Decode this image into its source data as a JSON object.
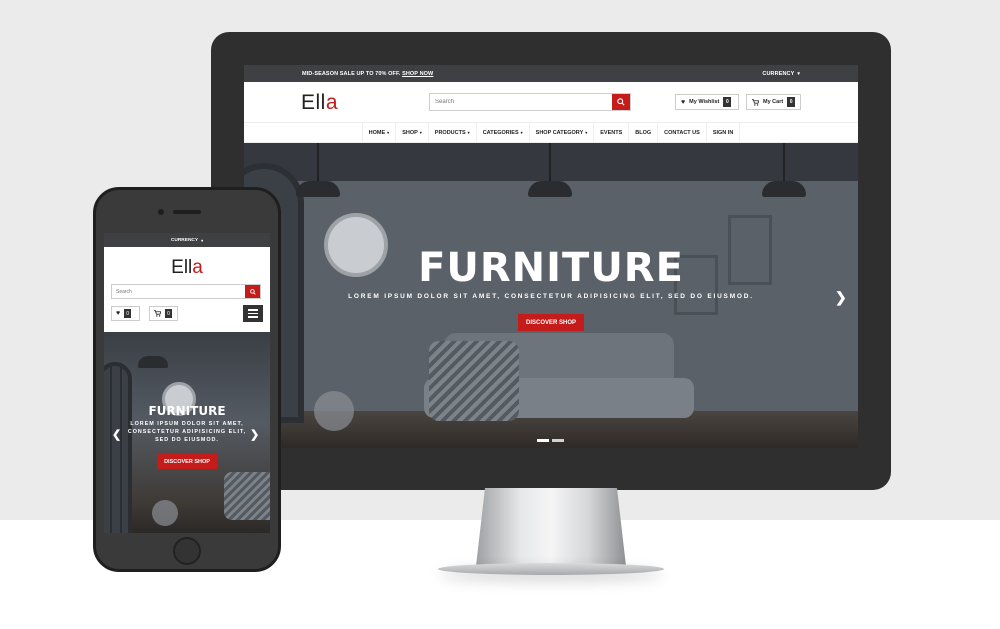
{
  "colors": {
    "accent": "#c41b1b",
    "topbar": "#3e4044",
    "device": "#2f2f2f"
  },
  "desktop": {
    "topbar": {
      "promo": "MID-SEASON SALE UP TO 70% OFF.",
      "promo_link": "SHOP NOW",
      "currency": "CURRENCY"
    },
    "logo": {
      "main": "Ell",
      "accent": "a"
    },
    "search": {
      "placeholder": "Search"
    },
    "wishlist": {
      "label": "My Wishlist",
      "count": "0"
    },
    "cart": {
      "label": "My Cart",
      "count": "0"
    },
    "nav": [
      {
        "label": "HOME",
        "dropdown": true
      },
      {
        "label": "SHOP",
        "dropdown": true
      },
      {
        "label": "PRODUCTS",
        "dropdown": true
      },
      {
        "label": "CATEGORIES",
        "dropdown": true
      },
      {
        "label": "SHOP CATEGORY",
        "dropdown": true
      },
      {
        "label": "EVENTS",
        "dropdown": false
      },
      {
        "label": "BLOG",
        "dropdown": false
      },
      {
        "label": "CONTACT US",
        "dropdown": false
      },
      {
        "label": "SIGN IN",
        "dropdown": false
      }
    ],
    "hero": {
      "title": "FURNITURE",
      "subtitle": "LOREM IPSUM DOLOR SIT AMET, CONSECTETUR ADIPISICING ELIT, SED DO EIUSMOD.",
      "button": "DISCOVER SHOP",
      "slides": 2,
      "active_slide": 1
    }
  },
  "mobile": {
    "topbar": {
      "currency": "CURRENCY"
    },
    "logo": {
      "main": "Ell",
      "accent": "a"
    },
    "search": {
      "placeholder": "Search"
    },
    "wishlist": {
      "count": "0"
    },
    "cart": {
      "count": "0"
    },
    "hero": {
      "title": "FURNITURE",
      "subtitle": "LOREM IPSUM DOLOR SIT AMET, CONSECTETUR ADIPISICING ELIT, SED DO EIUSMOD.",
      "button": "DISCOVER SHOP"
    }
  },
  "icons": {
    "search": "search-icon",
    "heart": "heart-icon",
    "cart": "cart-icon",
    "menu": "hamburger-menu-icon",
    "caret": "chevron-down-icon",
    "arrow_left": "chevron-left-icon",
    "arrow_right": "chevron-right-icon"
  }
}
